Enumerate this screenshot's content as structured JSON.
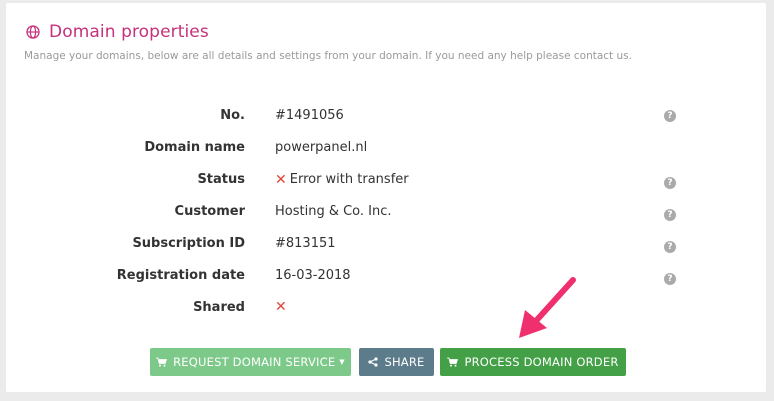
{
  "header": {
    "title": "Domain properties",
    "subtitle": "Manage your domains, below are all details and settings from your domain. If you need any help please contact us."
  },
  "properties": [
    {
      "label": "No.",
      "value": "#1491056",
      "help": true
    },
    {
      "label": "Domain name",
      "value": "powerpanel.nl",
      "help": false
    },
    {
      "label": "Status",
      "value": "Error with transfer",
      "status_icon": "x-icon",
      "help": true
    },
    {
      "label": "Customer",
      "value": "Hosting & Co. Inc.",
      "help": true
    },
    {
      "label": "Subscription ID",
      "value": "#813151",
      "help": true
    },
    {
      "label": "Registration date",
      "value": "16-03-2018",
      "help": true
    },
    {
      "label": "Shared",
      "value": "",
      "status_icon": "x-icon",
      "help": false
    }
  ],
  "help_symbol": "?",
  "buttons": {
    "request": "REQUEST DOMAIN SERVICE",
    "share": "SHARE",
    "process": "PROCESS DOMAIN ORDER"
  },
  "icons": {
    "title": "globe-icon",
    "request": "cart-icon",
    "share": "share-icon",
    "process": "cart-icon",
    "help": "question-icon",
    "error": "x-icon",
    "annotation": "pink-arrow"
  },
  "colors": {
    "accent": "#c5317b",
    "error": "#e0443a",
    "request_button": "#7dc98a",
    "share_button": "#5c7b8b",
    "process_button": "#43a047",
    "arrow": "#f0306e"
  }
}
